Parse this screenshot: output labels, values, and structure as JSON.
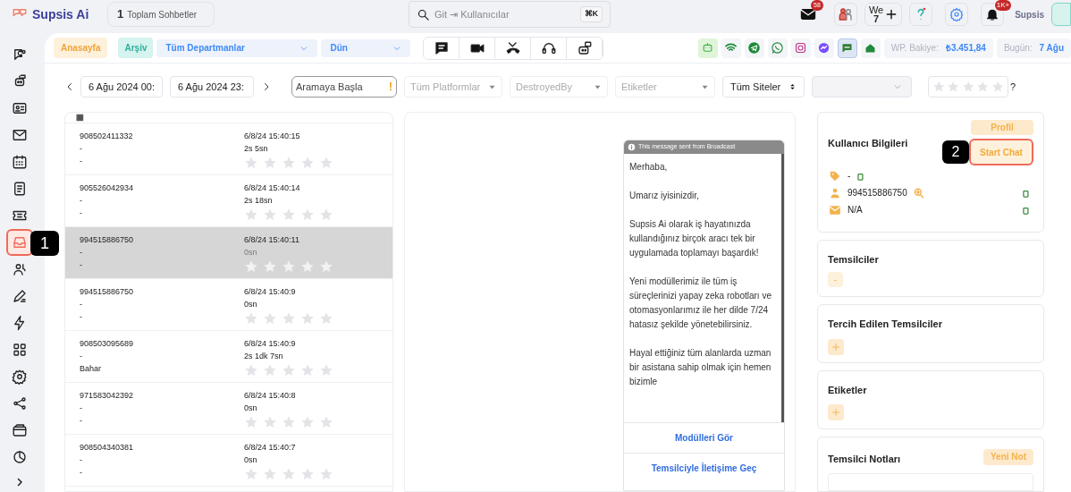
{
  "topbar": {
    "logo": "Supsis Ai",
    "chat_count": "1",
    "chat_count_label": "Toplam Sohbetler",
    "search": {
      "placeholder": "Git ⇥ Kullanıcılar"
    },
    "shortcut": "⌘K",
    "mail_badge": "58",
    "we_label": "We",
    "we_count": "7",
    "bell_badge": "1K+",
    "user": "Supsis"
  },
  "sidebar": {
    "items": [
      {
        "selected": false
      },
      {
        "selected": false
      },
      {
        "selected": false
      },
      {
        "selected": false
      },
      {
        "selected": false
      },
      {
        "selected": false
      },
      {
        "selected": false
      },
      {
        "selected": true
      },
      {
        "selected": false
      },
      {
        "selected": false
      },
      {
        "selected": false
      },
      {
        "selected": false
      },
      {
        "selected": false
      },
      {
        "selected": false
      },
      {
        "selected": false
      },
      {
        "selected": false
      }
    ]
  },
  "toolbar": {
    "home": "Anasayfa",
    "archive": "Arşiv",
    "department": "Tüm Departmanlar",
    "period": "Dün",
    "modes": [
      {
        "selected": false
      },
      {
        "selected": false
      },
      {
        "selected": false
      },
      {
        "selected": false
      },
      {
        "selected": false
      }
    ],
    "channels": [
      {
        "selected": false,
        "highlighted": true
      },
      {
        "selected": false,
        "highlighted": false
      },
      {
        "selected": false,
        "highlighted": false
      },
      {
        "selected": false,
        "highlighted": false
      },
      {
        "selected": false,
        "highlighted": false
      },
      {
        "selected": false,
        "highlighted": false
      },
      {
        "selected": true,
        "highlighted": false
      },
      {
        "selected": false,
        "highlighted": false
      }
    ],
    "balance_label": "WP. Bakiye:",
    "balance": "₺3.451,84",
    "today_label": "Bugün:",
    "today": "7 Ağu"
  },
  "filters": {
    "date_from": "6 Ağu 2024 00:",
    "date_to": "6 Ağu 2024 23:",
    "search": {
      "placeholder": "Aramaya Başla"
    },
    "search_warning": "!",
    "platforms": {
      "placeholder": "Tüm Platformlar"
    },
    "destroyed_by": {
      "placeholder": "DestroyedBy"
    },
    "tags": {
      "placeholder": "Etiketler"
    },
    "sites": "Tüm Siteler",
    "rating": {
      "stars": 0
    },
    "rating_help": "?"
  },
  "list": {
    "rows": [
      {
        "phone": "908502411332",
        "line_2": "-",
        "line_3": "-",
        "time": "6/8/24 15:40:15",
        "duration": "2s 5sn",
        "stars": 0,
        "selected": false
      },
      {
        "phone": "905526042934",
        "line_2": "-",
        "line_3": "-",
        "time": "6/8/24 15:40:14",
        "duration": "2s 18sn",
        "stars": 0,
        "selected": false
      },
      {
        "phone": "994515886750",
        "line_2": "-",
        "line_3": "-",
        "time": "6/8/24 15:40:11",
        "duration": "0sn",
        "stars": 0,
        "selected": true
      },
      {
        "phone": "994515886750",
        "line_2": "-",
        "line_3": "-",
        "time": "6/8/24 15:40:9",
        "duration": "0sn",
        "stars": 0,
        "selected": false
      },
      {
        "phone": "908503095689",
        "line_2": "-",
        "line_3": "Bahar",
        "time": "6/8/24 15:40:9",
        "duration": "2s 1dk 7sn",
        "stars": 0,
        "selected": false
      },
      {
        "phone": "971583042392",
        "line_2": "-",
        "line_3": "-",
        "time": "6/8/24 15:40:8",
        "duration": "0sn",
        "stars": 0,
        "selected": false
      },
      {
        "phone": "908504340381",
        "line_2": "-",
        "line_3": "-",
        "time": "6/8/24 15:40:7",
        "duration": "0sn",
        "stars": 0,
        "selected": false
      }
    ]
  },
  "message": {
    "notice": "This message sent from Broadcast",
    "paragraphs": [
      "Merhaba,",
      "Umarız iyisinizdir,",
      "Supsis Ai olarak iş hayatınızda kullandığınız birçok aracı tek bir uygulamada toplamayı başardık!",
      "Yeni modüllerimiz ile tüm iş süreçlerinizi yapay zeka robotları ve otomasyonlarımız ile her dilde 7/24 hatasız şekilde yönetebilirsiniz.",
      "Hayal ettiğiniz tüm alanlarda uzman bir asistana sahip olmak için hemen bizimle"
    ],
    "buttons": [
      "Modülleri Gör",
      "Temsilciyle İletişime Geç"
    ]
  },
  "user_info": {
    "title": "Kullanıcı Bilgileri",
    "profile_button": "Profil",
    "start_chat_button": "Start Chat",
    "tag": "-",
    "phone": "994515886750",
    "email": "N/A"
  },
  "representatives": {
    "title": "Temsilciler",
    "value": "-"
  },
  "preferred_representatives": {
    "title": "Tercih Edilen Temsilciler"
  },
  "tags": {
    "title": "Etiketler"
  },
  "notes": {
    "title": "Temsilci Notları",
    "new_button": "Yeni Not"
  },
  "callouts": [
    "1",
    "2"
  ]
}
